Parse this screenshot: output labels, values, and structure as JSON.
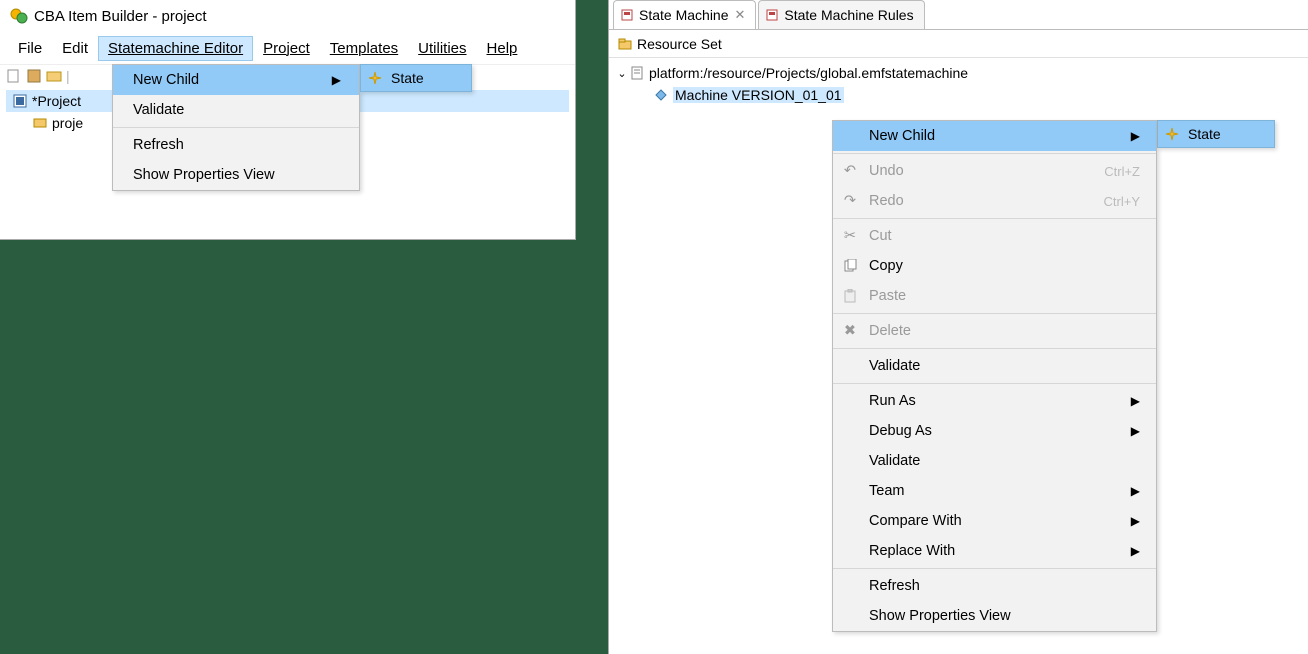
{
  "left": {
    "title": "CBA Item Builder - project",
    "menu": {
      "file": "File",
      "edit": "Edit",
      "statemachine": "Statemachine Editor",
      "project": "Project",
      "templates": "Templates",
      "utilities": "Utilities",
      "help": "Help"
    },
    "tree": {
      "root": "*Project",
      "child": "proje"
    },
    "dropdown": {
      "newchild": "New Child",
      "validate": "Validate",
      "refresh": "Refresh",
      "showprops": "Show Properties View"
    },
    "submenu_state": "State"
  },
  "right": {
    "tabs": {
      "sm": "State Machine",
      "smr": "State Machine Rules"
    },
    "resource_header": "Resource Set",
    "tree": {
      "platform": "platform:/resource/Projects/global.emfstatemachine",
      "machine": "Machine VERSION_01_01"
    },
    "ctx": {
      "newchild": "New Child",
      "undo": "Undo",
      "undo_sc": "Ctrl+Z",
      "redo": "Redo",
      "redo_sc": "Ctrl+Y",
      "cut": "Cut",
      "copy": "Copy",
      "paste": "Paste",
      "delete": "Delete",
      "validate1": "Validate",
      "runas": "Run As",
      "debugas": "Debug As",
      "validate2": "Validate",
      "team": "Team",
      "compare": "Compare With",
      "replace": "Replace With",
      "refresh": "Refresh",
      "showprops": "Show Properties View"
    },
    "submenu_state": "State"
  }
}
